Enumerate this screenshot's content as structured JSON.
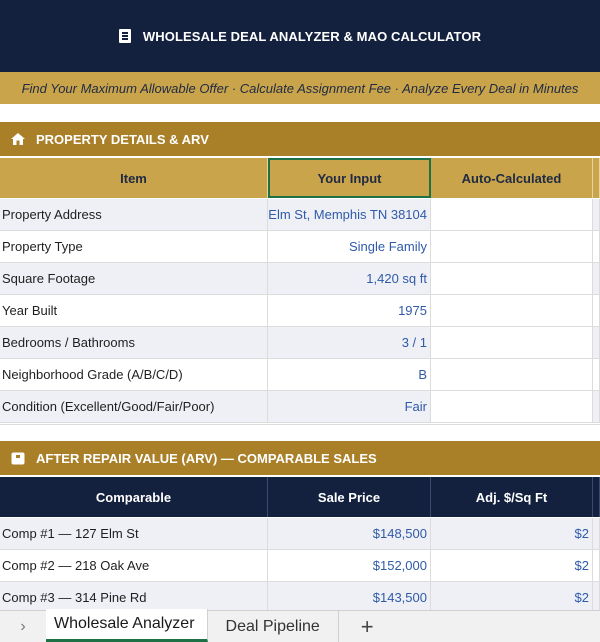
{
  "header": {
    "title": "WHOLESALE DEAL ANALYZER & MAO CALCULATOR",
    "subtitle": "Find Your Maximum Allowable Offer · Calculate Assignment Fee · Analyze Every Deal in Minutes"
  },
  "property_section": {
    "title": "PROPERTY DETAILS & ARV",
    "icon": "house-icon",
    "columns": [
      "Item",
      "Your Input",
      "Auto-Calculated"
    ],
    "rows": [
      {
        "label": "Property Address",
        "input": "Elm St, Memphis TN 38104",
        "auto": ""
      },
      {
        "label": "Property Type",
        "input": "Single Family",
        "auto": ""
      },
      {
        "label": "Square Footage",
        "input": "1,420 sq ft",
        "auto": ""
      },
      {
        "label": "Year Built",
        "input": "1975",
        "auto": ""
      },
      {
        "label": "Bedrooms / Bathrooms",
        "input": "3 / 1",
        "auto": ""
      },
      {
        "label": "Neighborhood Grade (A/B/C/D)",
        "input": "B",
        "auto": ""
      },
      {
        "label": "Condition (Excellent/Good/Fair/Poor)",
        "input": "Fair",
        "auto": ""
      }
    ]
  },
  "arv_section": {
    "title": "AFTER REPAIR VALUE (ARV) — COMPARABLE SALES",
    "icon": "box-icon",
    "columns": [
      "Comparable",
      "Sale Price",
      "Adj. $/Sq Ft"
    ],
    "rows": [
      {
        "label": "Comp #1 — 127 Elm St",
        "price": "$148,500",
        "adj": "$2"
      },
      {
        "label": "Comp #2 — 218 Oak Ave",
        "price": "$152,000",
        "adj": "$2"
      },
      {
        "label": "Comp #3 — 314 Pine Rd",
        "price": "$143,500",
        "adj": "$2"
      }
    ]
  },
  "tabs": {
    "items": [
      "Wholesale Analyzer",
      "Deal Pipeline"
    ],
    "active": "Wholesale Analyzer",
    "add": "+"
  },
  "colors": {
    "navy": "#13213f",
    "gold": "#c9a44a",
    "dark_gold": "#a97f28",
    "input_blue": "#2f5aa8",
    "selection_green": "#1e7145"
  }
}
